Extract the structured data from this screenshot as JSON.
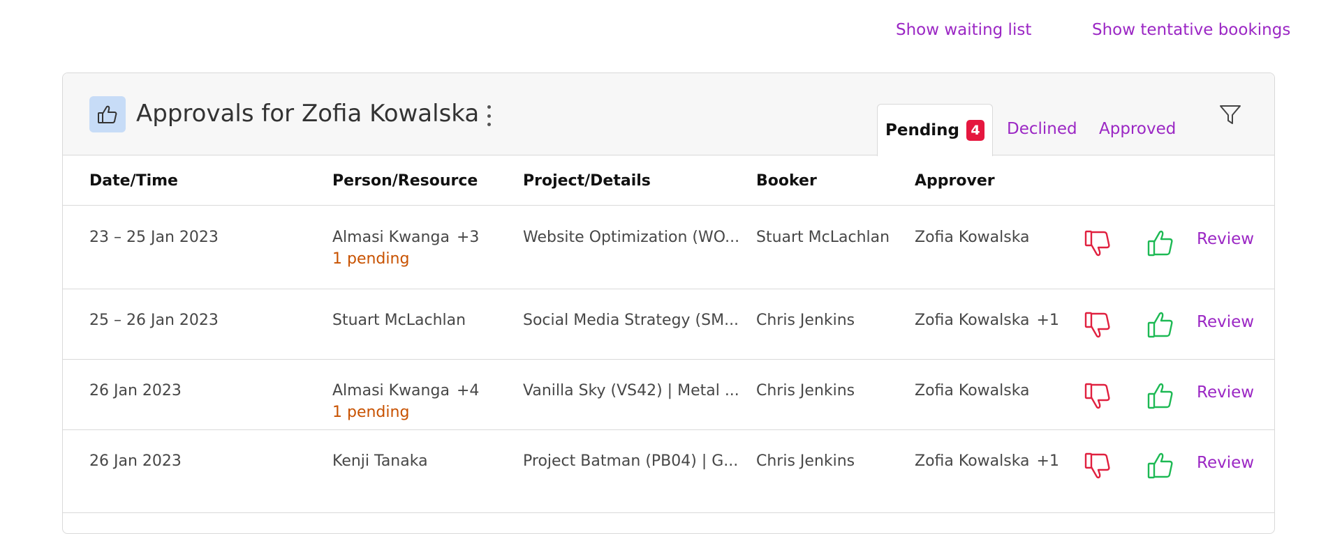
{
  "top_links": {
    "waiting_list": "Show waiting list",
    "tentative_bookings": "Show tentative bookings"
  },
  "card": {
    "icon": "thumbs-up-icon",
    "title": "Approvals for Zofia Kowalska",
    "tabs": {
      "pending": {
        "label": "Pending",
        "count": "4"
      },
      "declined": {
        "label": "Declined"
      },
      "approved": {
        "label": "Approved"
      }
    }
  },
  "columns": {
    "datetime": "Date/Time",
    "person": "Person/Resource",
    "project": "Project/Details",
    "booker": "Booker",
    "approver": "Approver"
  },
  "rows": [
    {
      "date": "23 – 25 Jan 2023",
      "person": "Almasi Kwanga",
      "person_extra": "+3",
      "pending": "1 pending",
      "project": "Website Optimization (WO...",
      "booker": "Stuart McLachlan",
      "approver": "Zofia Kowalska",
      "approver_extra": "",
      "review": "Review"
    },
    {
      "date": "25 – 26 Jan 2023",
      "person": "Stuart McLachlan",
      "person_extra": "",
      "pending": "",
      "project": "Social Media Strategy (SM...",
      "booker": "Chris Jenkins",
      "approver": "Zofia Kowalska",
      "approver_extra": "+1",
      "review": "Review"
    },
    {
      "date": "26 Jan 2023",
      "person": "Almasi Kwanga",
      "person_extra": "+4",
      "pending": "1 pending",
      "project": "Vanilla Sky (VS42) | Metal ...",
      "booker": "Chris Jenkins",
      "approver": "Zofia Kowalska",
      "approver_extra": "",
      "review": "Review"
    },
    {
      "date": "26 Jan 2023",
      "person": "Kenji Tanaka",
      "person_extra": "",
      "pending": "",
      "project": "Project Batman (PB04) | G...",
      "booker": "Chris Jenkins",
      "approver": "Zofia Kowalska",
      "approver_extra": "+1",
      "review": "Review"
    }
  ],
  "colors": {
    "accent": "#9b27c4",
    "decline": "#e0203f",
    "approve": "#1db954",
    "pending": "#c85200",
    "badge": "#e5173f"
  }
}
